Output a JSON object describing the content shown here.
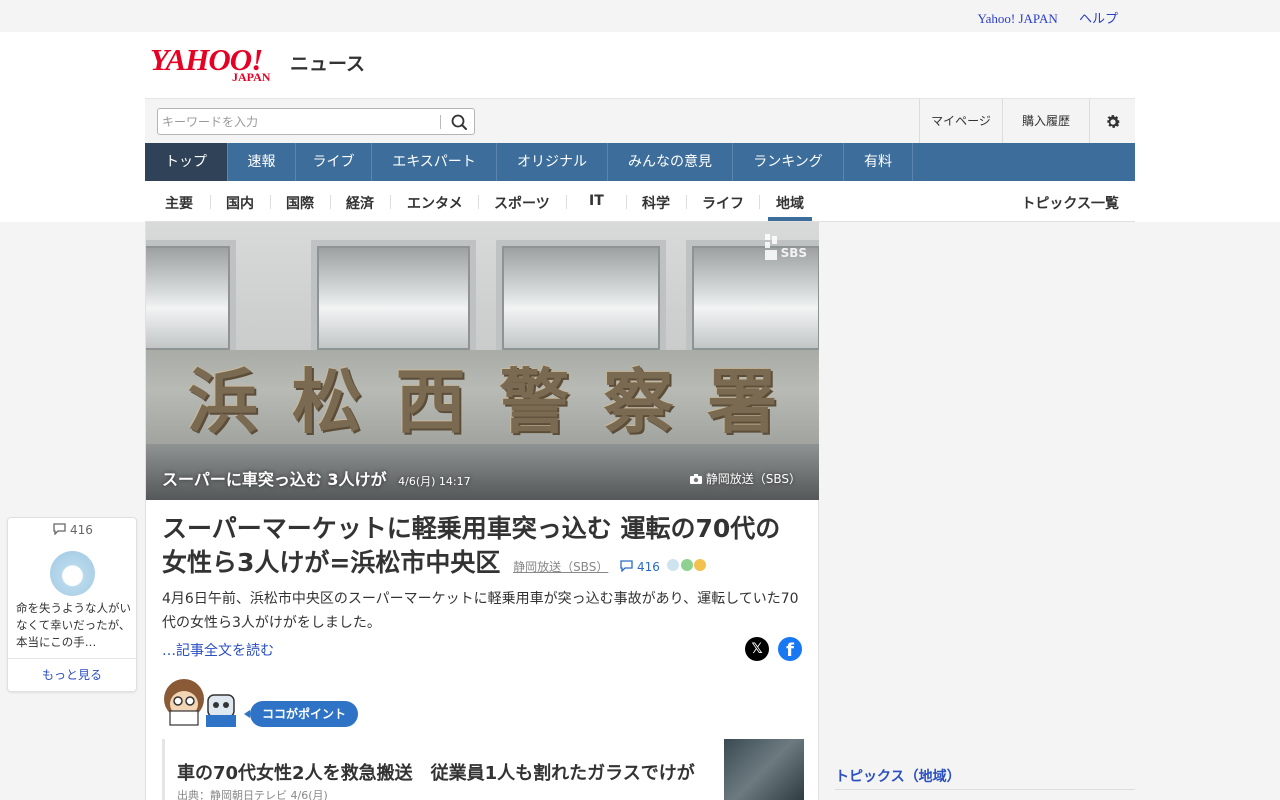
{
  "top_links": {
    "yahoo_japan": "Yahoo! JAPAN",
    "help": "ヘルプ"
  },
  "logo": {
    "yahoo": "YAHOO!",
    "japan": "JAPAN",
    "service": "ニュース"
  },
  "search": {
    "placeholder": "キーワードを入力",
    "value": ""
  },
  "header_links": {
    "mypage": "マイページ",
    "history": "購入履歴"
  },
  "nav": [
    {
      "label": "トップ",
      "active": true
    },
    {
      "label": "速報"
    },
    {
      "label": "ライブ"
    },
    {
      "label": "エキスパート"
    },
    {
      "label": "オリジナル"
    },
    {
      "label": "みんなの意見"
    },
    {
      "label": "ランキング"
    },
    {
      "label": "有料"
    }
  ],
  "subnav": {
    "items": [
      "主要",
      "国内",
      "国際",
      "経済",
      "エンタメ",
      "スポーツ",
      "IT",
      "科学",
      "ライフ",
      "地域"
    ],
    "active": "地域",
    "topics_link": "トピックス一覧"
  },
  "hero": {
    "sign_text": "浜松西警察署",
    "logo_text": "SBS",
    "caption": "スーパーに車突っ込む 3人けが",
    "time": "4/6(月) 14:17",
    "credit": "静岡放送（SBS）"
  },
  "article": {
    "title": "スーパーマーケットに軽乗用車突っ込む 運転の70代の女性ら3人けが=浜松市中央区",
    "source": "静岡放送（SBS）",
    "comment_count": "416",
    "summary": "4月6日午前、浜松市中央区のスーパーマーケットに軽乗用車が突っ込む事故があり、運転していた70代の女性ら3人がけがをしました。",
    "read_more": "…記事全文を読む"
  },
  "point": {
    "badge": "ココがポイント",
    "title": "車の70代女性2人を救急搬送　従業員1人も割れたガラスでけが",
    "source": "出典：静岡朝日テレビ 4/6(月)"
  },
  "comment_card": {
    "count": "416",
    "text": "命を失うような人がいなくて幸いだったが、本当にこの手…",
    "more": "もっと見る"
  },
  "sidebar": {
    "topics_title": "トピックス（地域）"
  },
  "colors": {
    "nav": "#3d6d9a",
    "nav_active": "#2f4257",
    "link": "#2a4fc0",
    "brand_red": "#e60023"
  }
}
